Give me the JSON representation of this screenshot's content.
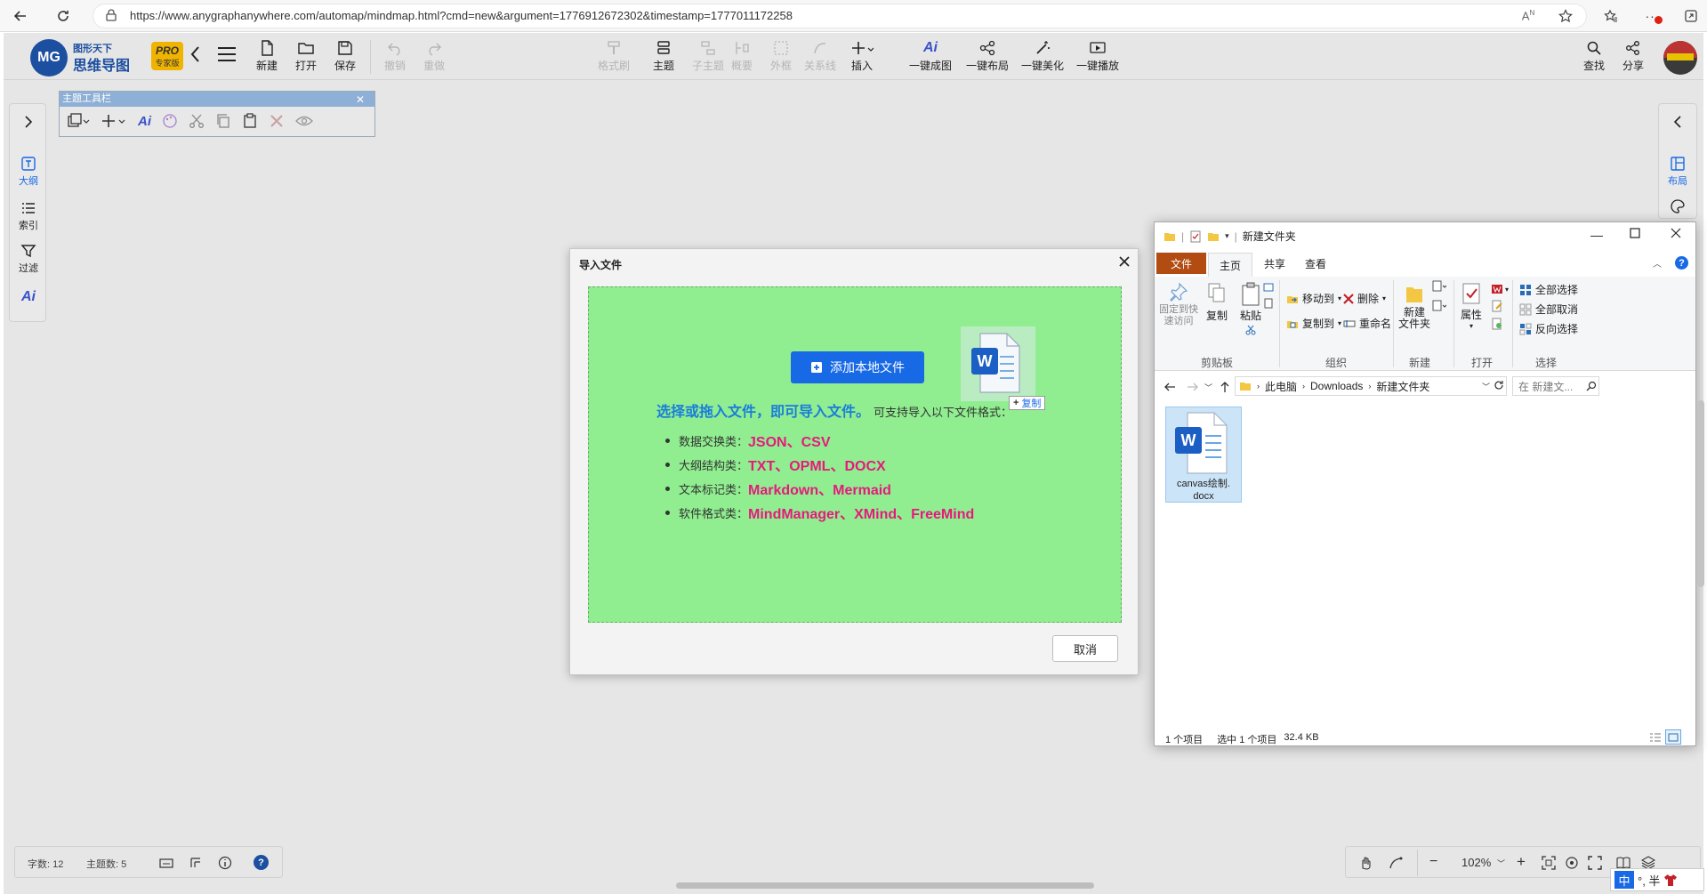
{
  "browser": {
    "url": "https://www.anygraphanywhere.com/automap/mindmap.html?cmd=new&argument=1776912672302&timestamp=1777011172258"
  },
  "app": {
    "logo_line1": "图形天下",
    "logo_line2": "思维导图",
    "badge_pro": "PRO",
    "badge_sub": "专家版",
    "toolbar": {
      "new": "新建",
      "open": "打开",
      "save": "保存",
      "undo": "撤销",
      "redo": "重做",
      "format_painter": "格式刷",
      "topic": "主题",
      "subtopic": "子主题",
      "summary": "概要",
      "boundary": "外框",
      "relation": "关系线",
      "insert": "插入",
      "ai_map": "一键成图",
      "ai_layout": "一键布局",
      "ai_beautify": "一键美化",
      "ai_play": "一键播放",
      "find": "查找",
      "share": "分享"
    },
    "left_panel": {
      "outline": "大纲",
      "index": "索引",
      "filter": "过滤"
    },
    "right_panel": {
      "layout": "布局"
    },
    "theme_toolbar_title": "主题工具栏",
    "status": {
      "word_count": "字数: 12",
      "topic_count": "主题数: 5",
      "zoom": "102%"
    }
  },
  "dialog": {
    "title": "导入文件",
    "add_button": "添加本地文件",
    "main_text": "选择或拖入文件，即可导入文件。",
    "sub_text": "可支持导入以下文件格式：",
    "copy_badge": "复制",
    "formats": [
      {
        "label": "数据交换类：",
        "value": "JSON、CSV"
      },
      {
        "label": "大纲结构类：",
        "value": "TXT、OPML、DOCX"
      },
      {
        "label": "文本标记类：",
        "value": "Markdown、Mermaid"
      },
      {
        "label": "软件格式类：",
        "value": "MindManager、XMind、FreeMind"
      }
    ],
    "cancel": "取消"
  },
  "explorer": {
    "title": "新建文件夹",
    "tabs": [
      "文件",
      "主页",
      "共享",
      "查看"
    ],
    "ribbon": {
      "pin": "固定到快\n速访问",
      "copy": "复制",
      "paste": "粘贴",
      "clipboard": "剪贴板",
      "move_to": "移动到",
      "copy_to": "复制到",
      "delete": "删除",
      "rename": "重命名",
      "organize": "组织",
      "new_folder": "新建\n文件夹",
      "new": "新建",
      "properties": "属性",
      "open": "打开",
      "select_all": "全部选择",
      "select_none": "全部取消",
      "invert": "反向选择",
      "select": "选择"
    },
    "path": [
      "此电脑",
      "Downloads",
      "新建文件夹"
    ],
    "search_placeholder": "在 新建文...",
    "file_name": "canvas绘制.\ndocx",
    "status_items": "1 个项目",
    "status_selected": "选中 1 个项目",
    "status_size": "32.4 KB"
  },
  "ime": {
    "mode": "中",
    "punct": "°, 半"
  },
  "colors": {
    "accent_blue": "#1769e6",
    "dropzone_green": "#90ee90",
    "format_pink": "#e6197d",
    "main_text_blue": "#1a7ddb"
  }
}
